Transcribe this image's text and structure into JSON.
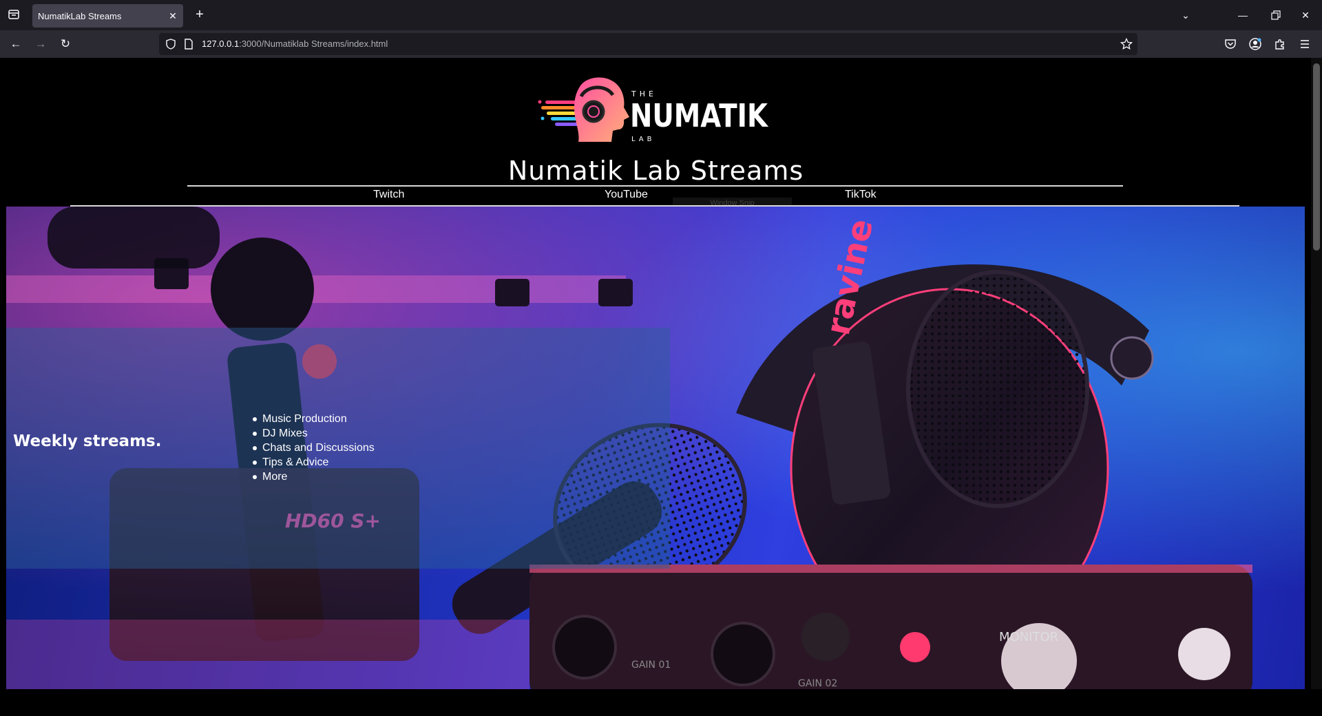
{
  "browser": {
    "tab_title": "NumatikLab Streams",
    "url_host": "127.0.0.1",
    "url_path": ":3000/Numatiklab Streams/index.html",
    "icons": [
      "tab-list-icon",
      "close-icon",
      "plus-icon",
      "chevron-down-icon",
      "minimize-icon",
      "restore-icon",
      "window-close-icon",
      "back-arrow-icon",
      "forward-arrow-icon",
      "reload-icon",
      "shield-icon",
      "page-icon",
      "star-icon",
      "pocket-icon",
      "account-icon",
      "extensions-icon",
      "menu-icon"
    ]
  },
  "site": {
    "logo": {
      "top": "THE",
      "main": "NUMATIK",
      "bottom": "LAB"
    },
    "title": "Numatik Lab Streams",
    "nav": [
      "Twitch",
      "YouTube",
      "TikTok"
    ],
    "ghost_tooltip": "Window Snip"
  },
  "hero": {
    "heading": "Weekly streams.",
    "items": [
      "Music Production",
      "DJ Mixes",
      "Chats and Discussions",
      "Tips & Advice",
      "More"
    ],
    "overlay_text": [
      "HD60 S+",
      "ravine",
      "MONITOR",
      "GAIN 01",
      "GAIN 02"
    ]
  },
  "colors": {
    "accent_pink": "#e0307a",
    "hero_blue": "#2f3fe0",
    "chrome_dark": "#1c1b22"
  }
}
